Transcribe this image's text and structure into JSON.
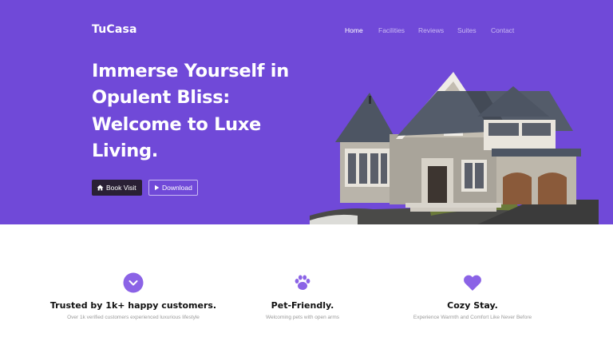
{
  "brand": {
    "name": "TuCasa"
  },
  "nav": {
    "items": [
      {
        "label": "Home",
        "active": true
      },
      {
        "label": "Facilities",
        "active": false
      },
      {
        "label": "Reviews",
        "active": false
      },
      {
        "label": "Suites",
        "active": false
      },
      {
        "label": "Contact",
        "active": false
      }
    ]
  },
  "hero": {
    "headline_lines": [
      "Immerse Yourself in",
      "Opulent Bliss:",
      "Welcome to Luxe",
      "Living."
    ],
    "buttons": {
      "book_visit": {
        "label": "Book Visit",
        "icon": "house-icon"
      },
      "download": {
        "label": "Download",
        "icon": "play-icon"
      }
    },
    "image": {
      "subject": "house-photo"
    }
  },
  "features": [
    {
      "icon": "chevron-down-icon",
      "title": "Trusted by 1k+ happy customers.",
      "subtitle": "Over 1k verified customers experienced luxurious lifestyle"
    },
    {
      "icon": "paw-icon",
      "title": "Pet-Friendly.",
      "subtitle": "Welcoming pets with open arms"
    },
    {
      "icon": "heart-icon",
      "title": "Cozy Stay.",
      "subtitle": "Experience Warmth and Comfort Like Never Before"
    }
  ],
  "colors": {
    "hero_bg": "#7049d8",
    "accent": "#8b63e6",
    "button_dark": "#2a2035",
    "text_dark": "#111111",
    "text_muted": "#9a9a9a"
  }
}
